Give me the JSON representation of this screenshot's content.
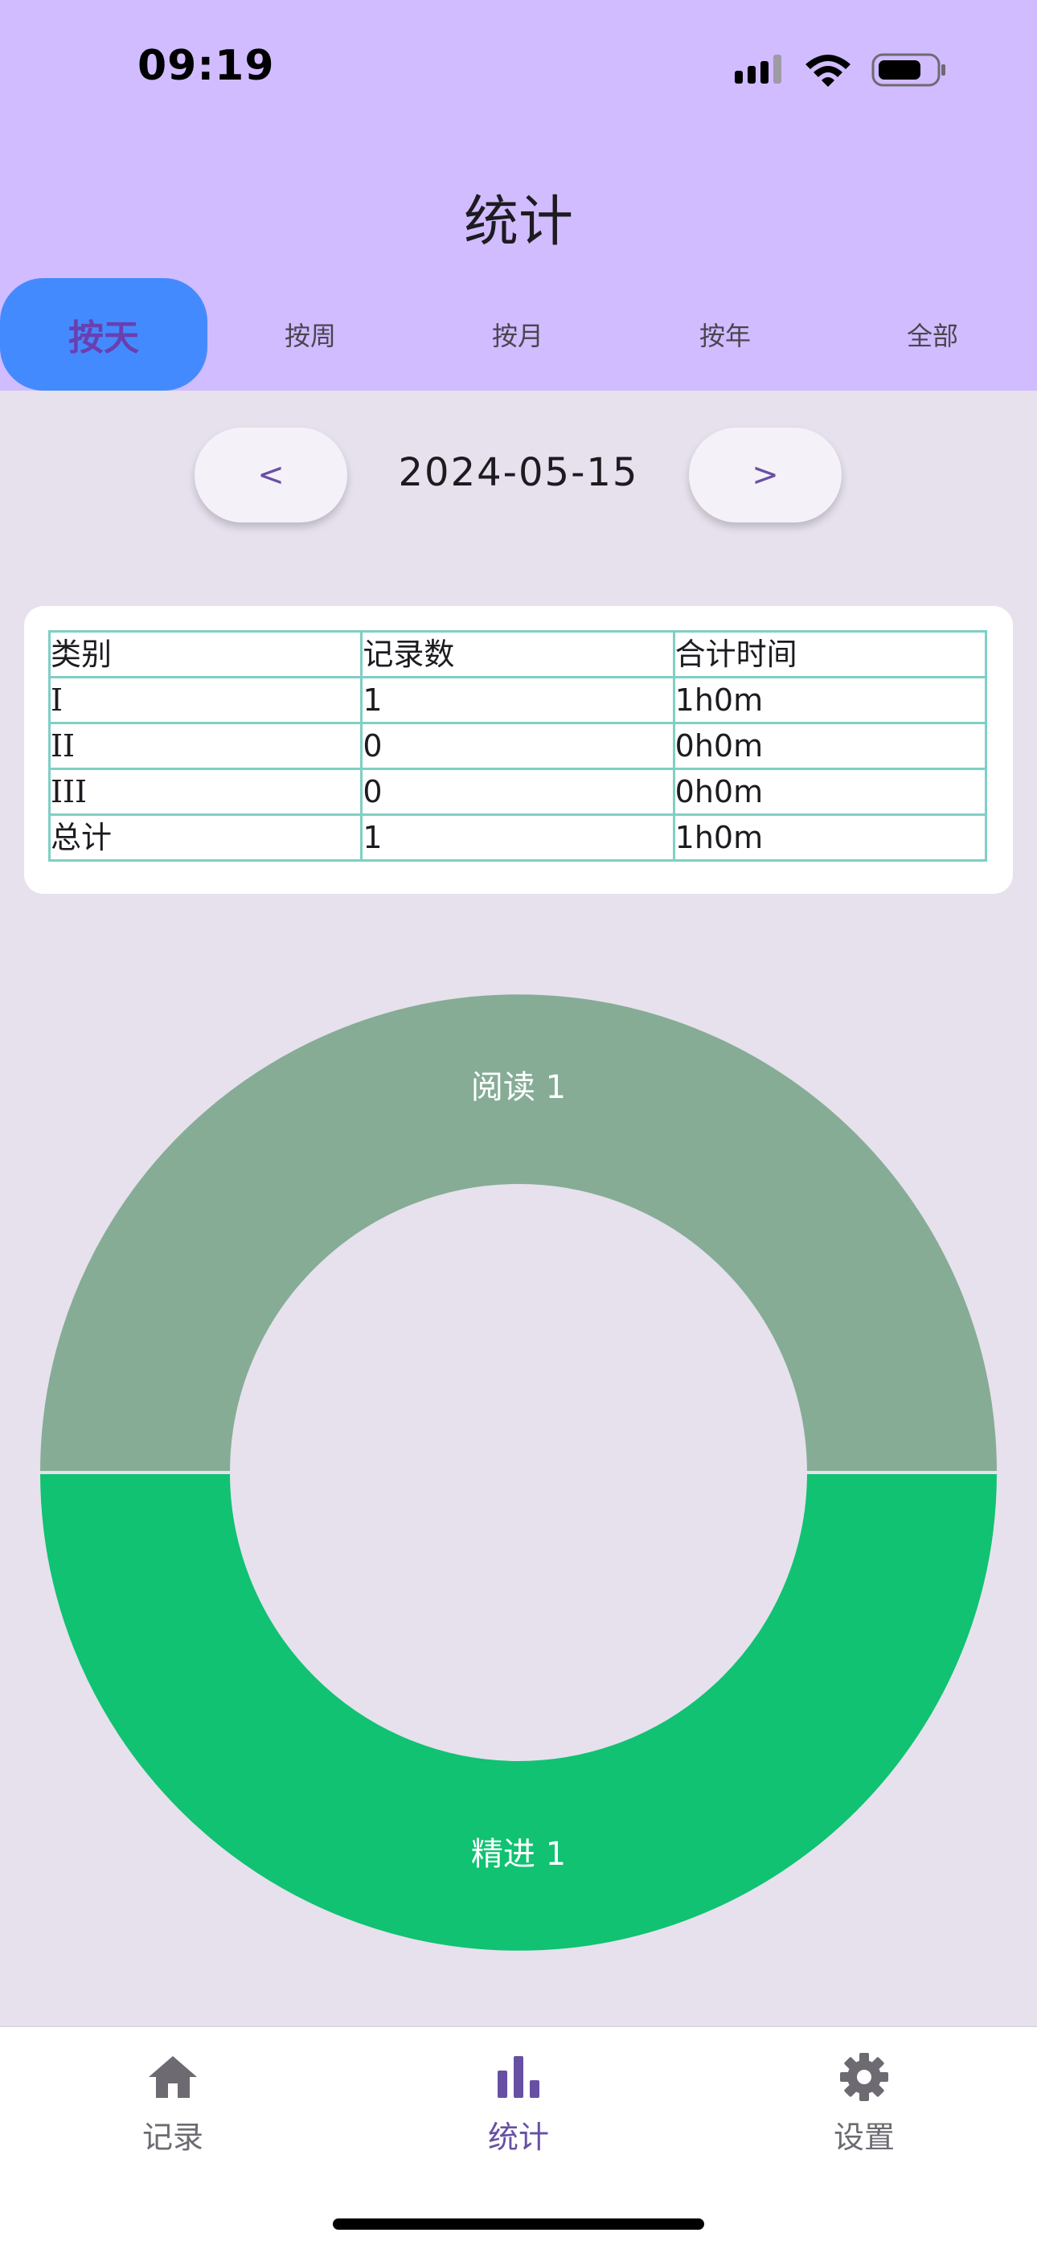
{
  "status_bar": {
    "time": "09:19"
  },
  "header": {
    "title": "统计"
  },
  "tabs": [
    {
      "label": "按天",
      "active": true
    },
    {
      "label": "按周",
      "active": false
    },
    {
      "label": "按月",
      "active": false
    },
    {
      "label": "按年",
      "active": false
    },
    {
      "label": "全部",
      "active": false
    }
  ],
  "date_nav": {
    "prev_label": "<",
    "date": "2024-05-15",
    "next_label": ">"
  },
  "table": {
    "headers": [
      "类别",
      "记录数",
      "合计时间"
    ],
    "rows": [
      [
        "I",
        "1",
        "1h0m"
      ],
      [
        "II",
        "0",
        "0h0m"
      ],
      [
        "III",
        "0",
        "0h0m"
      ],
      [
        "总计",
        "1",
        "1h0m"
      ]
    ]
  },
  "chart_data": {
    "type": "pie",
    "donut": true,
    "slices": [
      {
        "label": "阅读 1",
        "value": 1,
        "color": "#86ac95"
      },
      {
        "label": "精进 1",
        "value": 1,
        "color": "#10c272"
      }
    ]
  },
  "bottom_nav": [
    {
      "icon": "home-icon",
      "label": "记录",
      "active": false
    },
    {
      "icon": "bar-chart-icon",
      "label": "统计",
      "active": true
    },
    {
      "icon": "gear-icon",
      "label": "设置",
      "active": false
    }
  ],
  "colors": {
    "header_bg": "#d1bcff",
    "tab_active_bg": "#448aff",
    "accent": "#6750a4",
    "table_border": "#7fcfc4",
    "page_bg": "#e6e1ed"
  }
}
